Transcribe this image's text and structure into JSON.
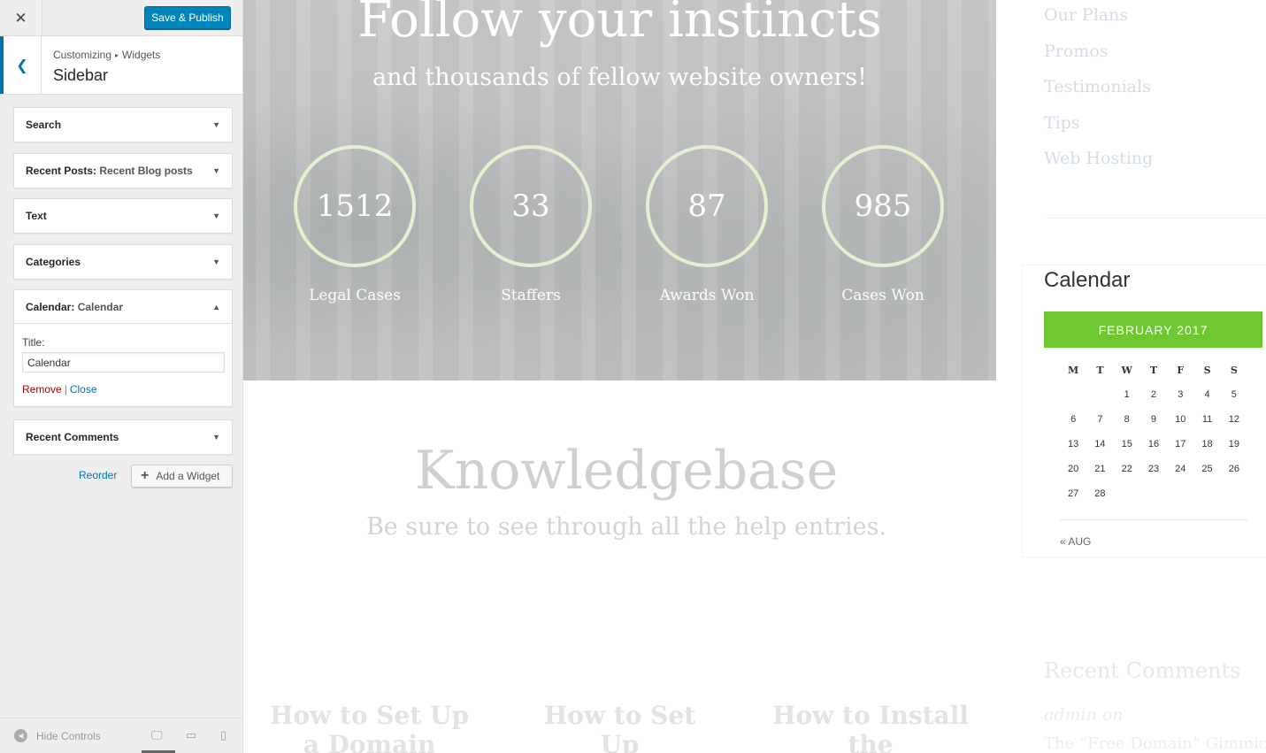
{
  "customizer": {
    "close_icon": "close-icon",
    "publish_label": "Save & Publish",
    "breadcrumb": {
      "root": "Customizing",
      "section": "Widgets"
    },
    "section_title": "Sidebar",
    "widgets": [
      {
        "name": "Search",
        "sub": ""
      },
      {
        "name": "Recent Posts:",
        "sub": "Recent Blog posts"
      },
      {
        "name": "Text",
        "sub": ""
      },
      {
        "name": "Categories",
        "sub": ""
      },
      {
        "name": "Calendar:",
        "sub": "Calendar"
      },
      {
        "name": "Recent Comments",
        "sub": ""
      }
    ],
    "calendar_form": {
      "title_label": "Title:",
      "title_value": "Calendar",
      "remove_label": "Remove",
      "separator": "|",
      "close_label": "Close"
    },
    "reorder_label": "Reorder",
    "add_widget_label": "Add a Widget",
    "hide_controls_label": "Hide Controls"
  },
  "preview": {
    "hero": {
      "title": "Follow your instincts",
      "subtitle": "and thousands of fellow website owners!",
      "stats": [
        {
          "value": "1512",
          "label": "Legal Cases"
        },
        {
          "value": "33",
          "label": "Staffers"
        },
        {
          "value": "87",
          "label": "Awards Won"
        },
        {
          "value": "985",
          "label": "Cases Won"
        }
      ]
    },
    "knowledgebase": {
      "title": "Knowledgebase",
      "subtitle": "Be sure to see through all the help entries.",
      "articles": [
        "How to Set Up a Domain",
        "How to Set Up WordPress",
        "How to Install the Certificate?"
      ]
    },
    "sidebar": {
      "links": [
        "Our Plans",
        "Promos",
        "Testimonials",
        "Tips",
        "Web Hosting"
      ],
      "calendar": {
        "heading": "Calendar",
        "month": "FEBRUARY 2017",
        "days_of_week": [
          "M",
          "T",
          "W",
          "T",
          "F",
          "S",
          "S"
        ],
        "weeks": [
          [
            "",
            "",
            "1",
            "2",
            "3",
            "4",
            "5"
          ],
          [
            "6",
            "7",
            "8",
            "9",
            "10",
            "11",
            "12"
          ],
          [
            "13",
            "14",
            "15",
            "16",
            "17",
            "18",
            "19"
          ],
          [
            "20",
            "21",
            "22",
            "23",
            "24",
            "25",
            "26"
          ],
          [
            "27",
            "28",
            "",
            "",
            "",
            "",
            ""
          ]
        ],
        "prev_link": "« AUG",
        "accent": "#6ec832"
      },
      "recent_comments_heading": "Recent Comments",
      "comment_author": "admin on",
      "comment_post": "The “Free Domain” Gimmick"
    }
  }
}
